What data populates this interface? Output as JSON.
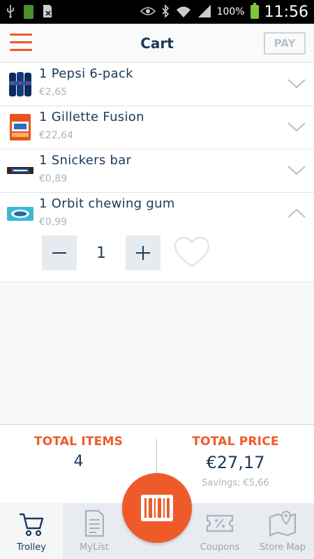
{
  "status_bar": {
    "battery_percent": "100%",
    "time": "11:56",
    "icons": [
      "usb-icon",
      "battery-badge-icon",
      "sim-icon",
      "eye-icon",
      "bluetooth-icon",
      "wifi-icon",
      "signal-icon",
      "battery-icon"
    ]
  },
  "header": {
    "title": "Cart",
    "pay_label": "PAY"
  },
  "cart": {
    "items": [
      {
        "name": "1 Pepsi 6-pack",
        "price": "€2,65",
        "expanded": false
      },
      {
        "name": "1 Gillette Fusion",
        "price": "€22,64",
        "expanded": false
      },
      {
        "name": "1 Snickers bar",
        "price": "€0,89",
        "expanded": false
      },
      {
        "name": "1 Orbit chewing gum",
        "price": "€0,99",
        "expanded": true,
        "quantity": "1"
      }
    ]
  },
  "summary": {
    "total_items_label": "TOTAL ITEMS",
    "total_items_value": "4",
    "total_price_label": "TOTAL PRICE",
    "total_price_value": "€27,17",
    "savings": "Savings: €5,66"
  },
  "nav": {
    "items": [
      {
        "label": "Trolley",
        "icon": "cart-icon",
        "active": true
      },
      {
        "label": "MyList",
        "icon": "list-icon",
        "active": false
      },
      {
        "label": "Coupons",
        "icon": "coupon-icon",
        "active": false
      },
      {
        "label": "Store Map",
        "icon": "map-icon",
        "active": false
      }
    ]
  },
  "colors": {
    "accent": "#ee5a2a",
    "text": "#1b3a5a",
    "muted": "#aab4bd",
    "nav_bg": "#e8ecf0"
  }
}
